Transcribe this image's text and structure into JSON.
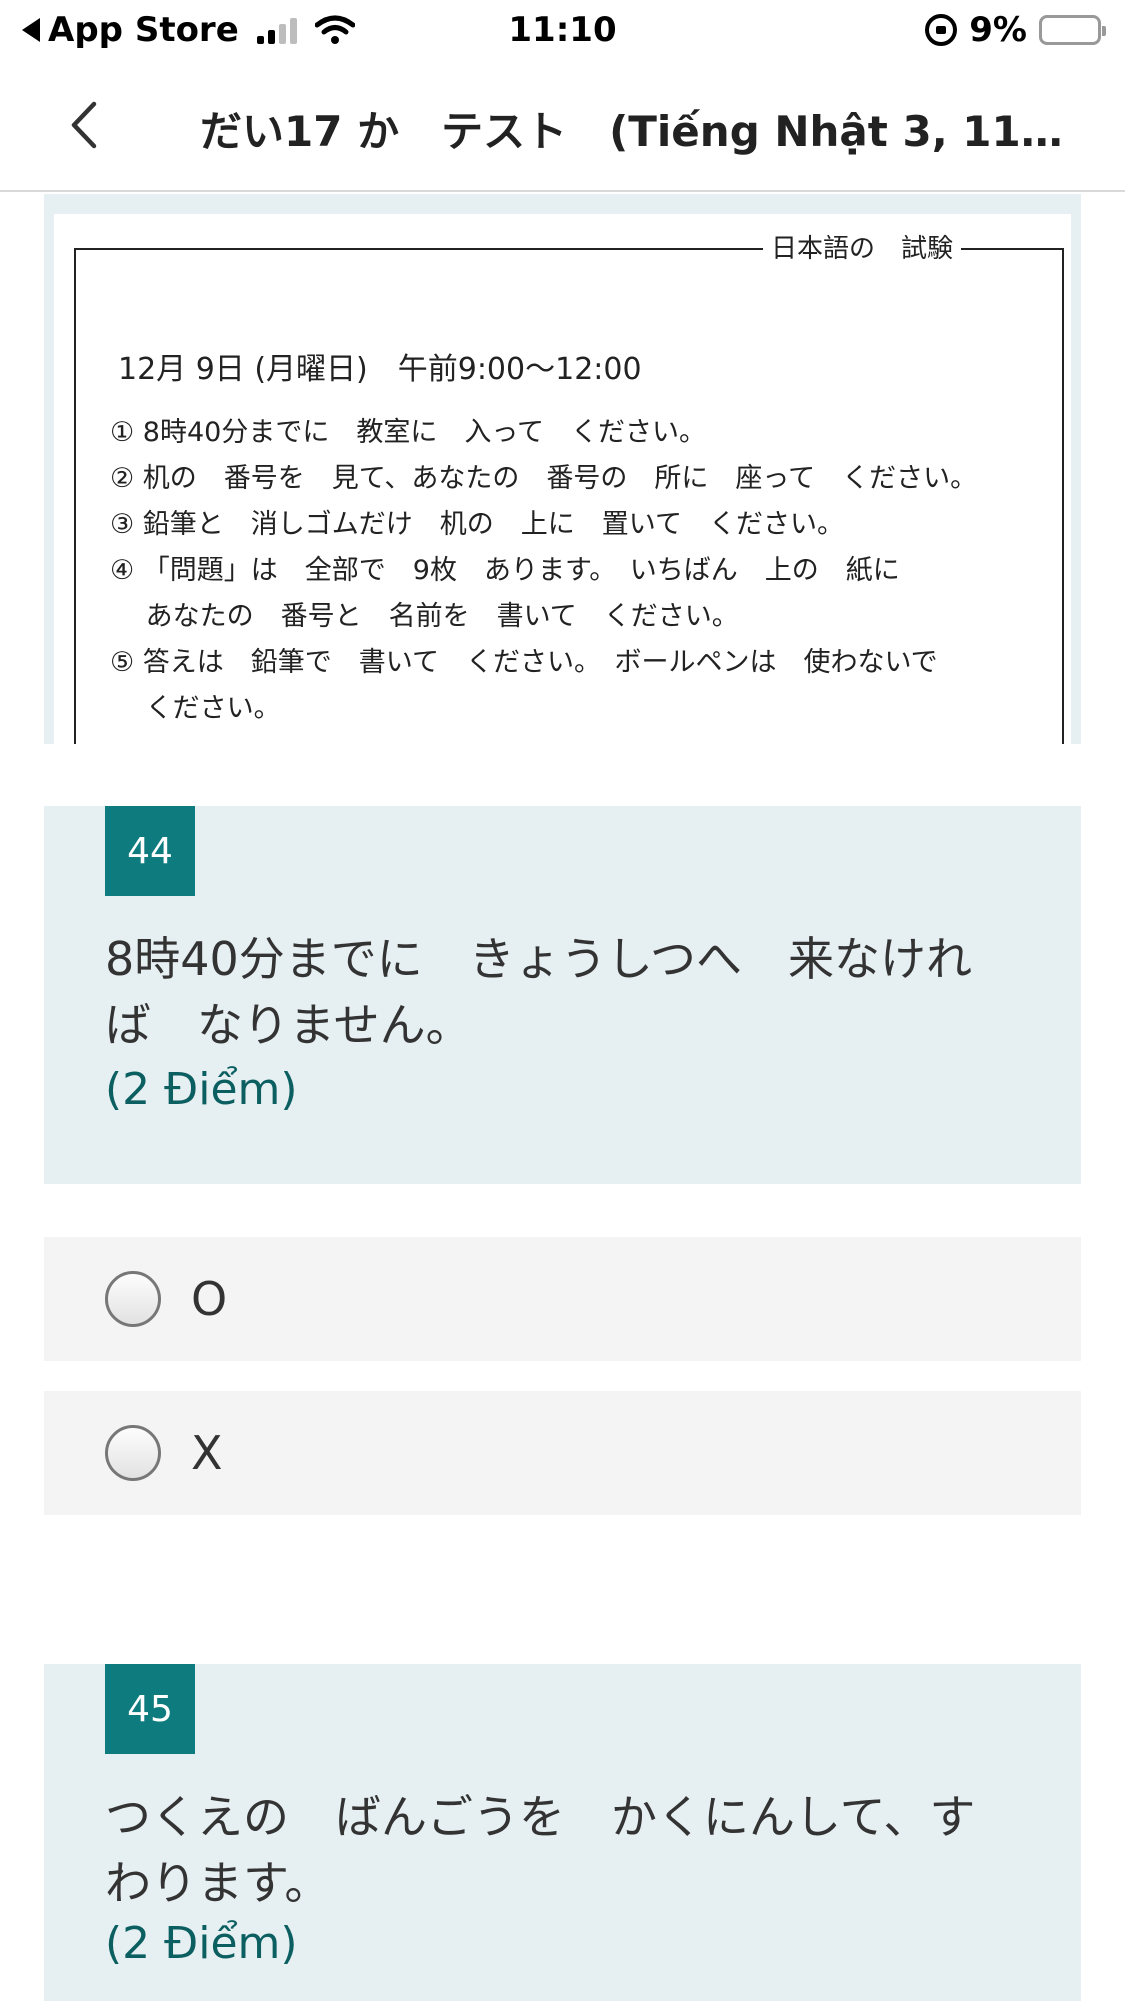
{
  "status_bar": {
    "carrier": "App Store",
    "time": "11:10",
    "battery": "9%",
    "battery_level": 0.09
  },
  "nav": {
    "title": "だい17 か　テスト　(Tiếng Nhật 3, 118..."
  },
  "exam_image": {
    "header_label": "日本語の　試験",
    "date_line": "12月 9日 (月曜日)　午前9:00～12:00",
    "lines": [
      "① 8時40分までに　教室に　入って　ください。",
      "② 机の　番号を　見て、あなたの　番号の　所に　座って　ください。",
      "③ 鉛筆と　消しゴムだけ　机の　上に　置いて　ください。",
      "④ 「問題」は　全部で　9枚　あります。　いちばん　上の　紙に",
      "　 あなたの　番号と　名前を　書いて　ください。",
      "⑤ 答えは　鉛筆で　書いて　ください。　ボールペンは　使わないで",
      "　 ください。"
    ]
  },
  "questions": [
    {
      "number": "44",
      "text": "8時40分までに　きょうしつへ　来なければ　なりません。",
      "points": "(2 Điểm)",
      "options": [
        "O",
        "X"
      ]
    },
    {
      "number": "45",
      "text": "つくえの　ばんごうを　かくにんして、すわります。",
      "points": "(2 Điểm)"
    }
  ]
}
